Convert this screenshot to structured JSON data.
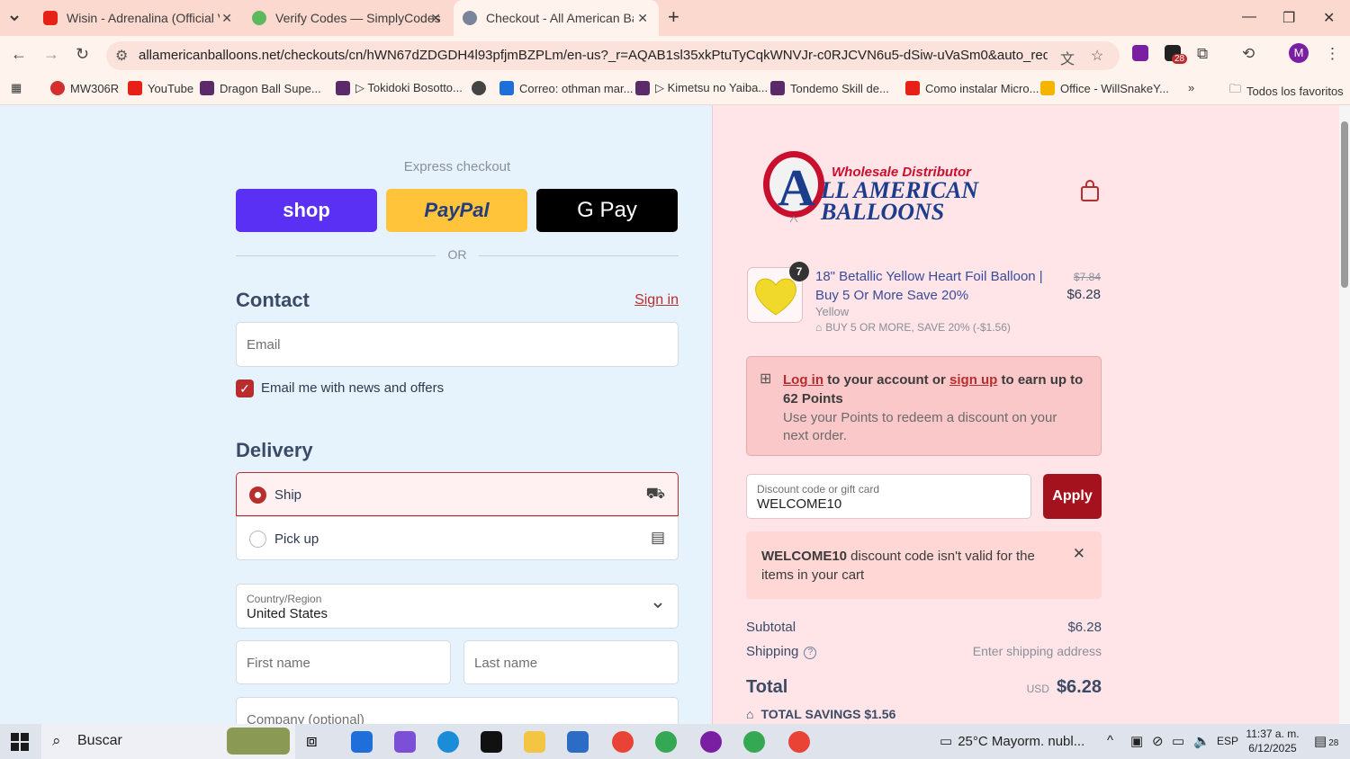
{
  "browser": {
    "tabs": [
      {
        "title": "Wisin - Adrenalina (Official Vide"
      },
      {
        "title": "Verify Codes — SimplyCodes"
      },
      {
        "title": "Checkout - All American Balloo"
      }
    ],
    "url": "allamericanballoons.net/checkouts/cn/hWN67dZDGDH4l93pfjmBZPLm/en-us?_r=AQAB1sl35xkPtuTyCqkWNVJr-c0RJCVN6u5-dSiw-uVaSm0&auto_redirect=false&skip...",
    "extensions_badge": "28",
    "profile_initial": "M",
    "bookmarks": [
      {
        "label": "MW306R",
        "color": "#d32f2f"
      },
      {
        "label": "YouTube",
        "color": "#e62117"
      },
      {
        "label": "Dragon Ball Supe...",
        "color": "#5a2a6a"
      },
      {
        "label": "▷ Tokidoki Bosotto...",
        "color": "#5a2a6a"
      },
      {
        "label": "",
        "color": "#444444"
      },
      {
        "label": "Correo: othman mar...",
        "color": "#1e6fd9"
      },
      {
        "label": "▷ Kimetsu no Yaiba...",
        "color": "#5a2a6a"
      },
      {
        "label": "Tondemo Skill de...",
        "color": "#5a2a6a"
      },
      {
        "label": "Como instalar Micro...",
        "color": "#e62117"
      },
      {
        "label": "Office - WillSnakeY...",
        "color": "#f4b400"
      }
    ],
    "all_bookmarks": "Todos los favoritos"
  },
  "checkout": {
    "express_label": "Express checkout",
    "shop_label": "shop",
    "paypal_label": "PayPal",
    "gpay_label": "G Pay",
    "or_label": "OR",
    "contact_title": "Contact",
    "sign_in": "Sign in",
    "email_placeholder": "Email",
    "news_label": "Email me with news and offers",
    "delivery_title": "Delivery",
    "ship_label": "Ship",
    "pickup_label": "Pick up",
    "country_label": "Country/Region",
    "country_value": "United States",
    "first_name": "First name",
    "last_name": "Last name",
    "company": "Company (optional)"
  },
  "summary": {
    "logo_top": "Wholesale Distributor",
    "logo_main": "LL AMERICAN",
    "logo_sub": "BALLOONS",
    "logo_letter": "A",
    "qty": "7",
    "product_title": "18\" Betallic Yellow Heart Foil Balloon | Buy 5 Or More Save 20%",
    "variant": "Yellow",
    "discount_line": "BUY 5 OR MORE, SAVE 20% (-$1.56)",
    "price_old": "$7.84",
    "price_new": "$6.28",
    "points_login": "Log in",
    "points_mid": " to your account or ",
    "points_signup": "sign up",
    "points_end": " to earn up to 62 Points",
    "points_sub": "Use your Points to redeem a discount on your next order.",
    "discount_label": "Discount code or gift card",
    "discount_value": "WELCOME10",
    "apply": "Apply",
    "error_code": "WELCOME10",
    "error_msg": " discount code isn't valid for the items in your cart",
    "subtotal_label": "Subtotal",
    "subtotal_value": "$6.28",
    "shipping_label": "Shipping",
    "shipping_value": "Enter shipping address",
    "total_label": "Total",
    "total_currency": "USD",
    "total_value": "$6.28",
    "savings_label": "TOTAL SAVINGS",
    "savings_value": "$1.56"
  },
  "taskbar": {
    "search": "Buscar",
    "weather": "25°C  Mayorm. nubl...",
    "lang": "ESP",
    "time": "11:37 a. m.",
    "date": "6/12/2025",
    "notif": "28"
  }
}
